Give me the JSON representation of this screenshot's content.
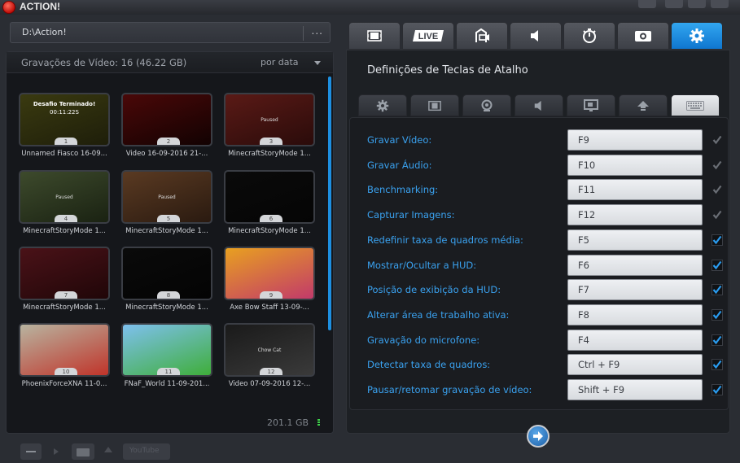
{
  "app": {
    "title": "ACTION!"
  },
  "path": {
    "value": "D:\\Action!",
    "more_label": "..."
  },
  "library": {
    "title": "Gravações de Vídeo: 16 (46.22 GB)",
    "sort_label": "por data",
    "free_space": "201.1 GB",
    "items": [
      {
        "number": "1",
        "label": "Unnamed Fiasco 16-09...",
        "overlay_title": "Desafio Terminado!",
        "overlay_time": "00:11:22S",
        "colors": [
          "#3a3a10",
          "#1e1e0a"
        ]
      },
      {
        "number": "2",
        "label": "Video 16-09-2016 21-...",
        "colors": [
          "#4a0808",
          "#120202"
        ]
      },
      {
        "number": "3",
        "label": "MinecraftStoryMode 1...",
        "overlay": "Paused",
        "colors": [
          "#5a1a16",
          "#2a0b0a"
        ]
      },
      {
        "number": "4",
        "label": "MinecraftStoryMode 1...",
        "overlay": "Paused",
        "colors": [
          "#3d4a2c",
          "#1a2212"
        ]
      },
      {
        "number": "5",
        "label": "MinecraftStoryMode 1...",
        "overlay": "Paused",
        "colors": [
          "#5a3a22",
          "#2a1a10"
        ]
      },
      {
        "number": "6",
        "label": "MinecraftStoryMode 1...",
        "colors": [
          "#0a0a0a",
          "#050505"
        ]
      },
      {
        "number": "7",
        "label": "MinecraftStoryMode 1...",
        "colors": [
          "#4a1218",
          "#200608"
        ]
      },
      {
        "number": "8",
        "label": "MinecraftStoryMode 1...",
        "colors": [
          "#0a0a0a",
          "#040404"
        ]
      },
      {
        "number": "9",
        "label": "Axe Bow Staff 13-09-...",
        "colors": [
          "#e8a020",
          "#c23a6a"
        ]
      },
      {
        "number": "10",
        "label": "PhoenixForceXNA 11-0...",
        "colors": [
          "#b8b4a0",
          "#c0342a"
        ]
      },
      {
        "number": "11",
        "label": "FNaF_World 11-09-201...",
        "colors": [
          "#7ec0ee",
          "#3fae3a"
        ]
      },
      {
        "number": "12",
        "label": "Video 07-09-2016 12-...",
        "overlay": "Chow Cat",
        "colors": [
          "#1a1a1a",
          "#3a3a3a"
        ]
      }
    ]
  },
  "bottom_toolbar": {
    "youtube_label": "YouTube"
  },
  "settings": {
    "title": "Definições de Teclas de Atalho",
    "top_tabs": [
      {
        "name": "recordings-tab",
        "icon": "film-icon"
      },
      {
        "name": "live-tab",
        "icon": "live-icon",
        "text": "LIVE"
      },
      {
        "name": "benchmark-tab",
        "icon": "benchmark-icon"
      },
      {
        "name": "audio-tab",
        "icon": "speaker-icon"
      },
      {
        "name": "timer-tab",
        "icon": "stopwatch-icon"
      },
      {
        "name": "screenshot-tab",
        "icon": "camera-icon"
      },
      {
        "name": "settings-tab",
        "icon": "gear-icon",
        "active": true
      }
    ],
    "sub_tabs": [
      {
        "name": "general",
        "icon": "gear-icon"
      },
      {
        "name": "video",
        "icon": "film-icon"
      },
      {
        "name": "webcam",
        "icon": "webcam-icon"
      },
      {
        "name": "audio",
        "icon": "speaker-icon"
      },
      {
        "name": "monitor",
        "icon": "monitor-icon"
      },
      {
        "name": "upload",
        "icon": "upload-icon"
      },
      {
        "name": "hotkeys",
        "icon": "keyboard-icon",
        "active": true
      }
    ],
    "hotkeys": [
      {
        "label": "Gravar Vídeo:",
        "key": "F9",
        "checked": false
      },
      {
        "label": "Gravar Áudio:",
        "key": "F10",
        "checked": false
      },
      {
        "label": "Benchmarking:",
        "key": "F11",
        "checked": false
      },
      {
        "label": "Capturar Imagens:",
        "key": "F12",
        "checked": false
      },
      {
        "label": "Redefinir taxa de quadros média:",
        "key": "F5",
        "checked": true
      },
      {
        "label": "Mostrar/Ocultar a HUD:",
        "key": "F6",
        "checked": true
      },
      {
        "label": "Posição de exibição da HUD:",
        "key": "F7",
        "checked": true
      },
      {
        "label": "Alterar área de trabalho ativa:",
        "key": "F8",
        "checked": true
      },
      {
        "label": "Gravação do microfone:",
        "key": "F4",
        "checked": true
      },
      {
        "label": "Detectar taxa de quadros:",
        "key": "Ctrl + F9",
        "checked": true
      },
      {
        "label": "Pausar/retomar gravação de vídeo:",
        "key": "Shift + F9",
        "checked": true
      }
    ],
    "colors": {
      "accent": "#1a8ae6",
      "label": "#3aa2f0",
      "check_on": "#2a9cf0",
      "check_off": "#6a6e75"
    }
  }
}
